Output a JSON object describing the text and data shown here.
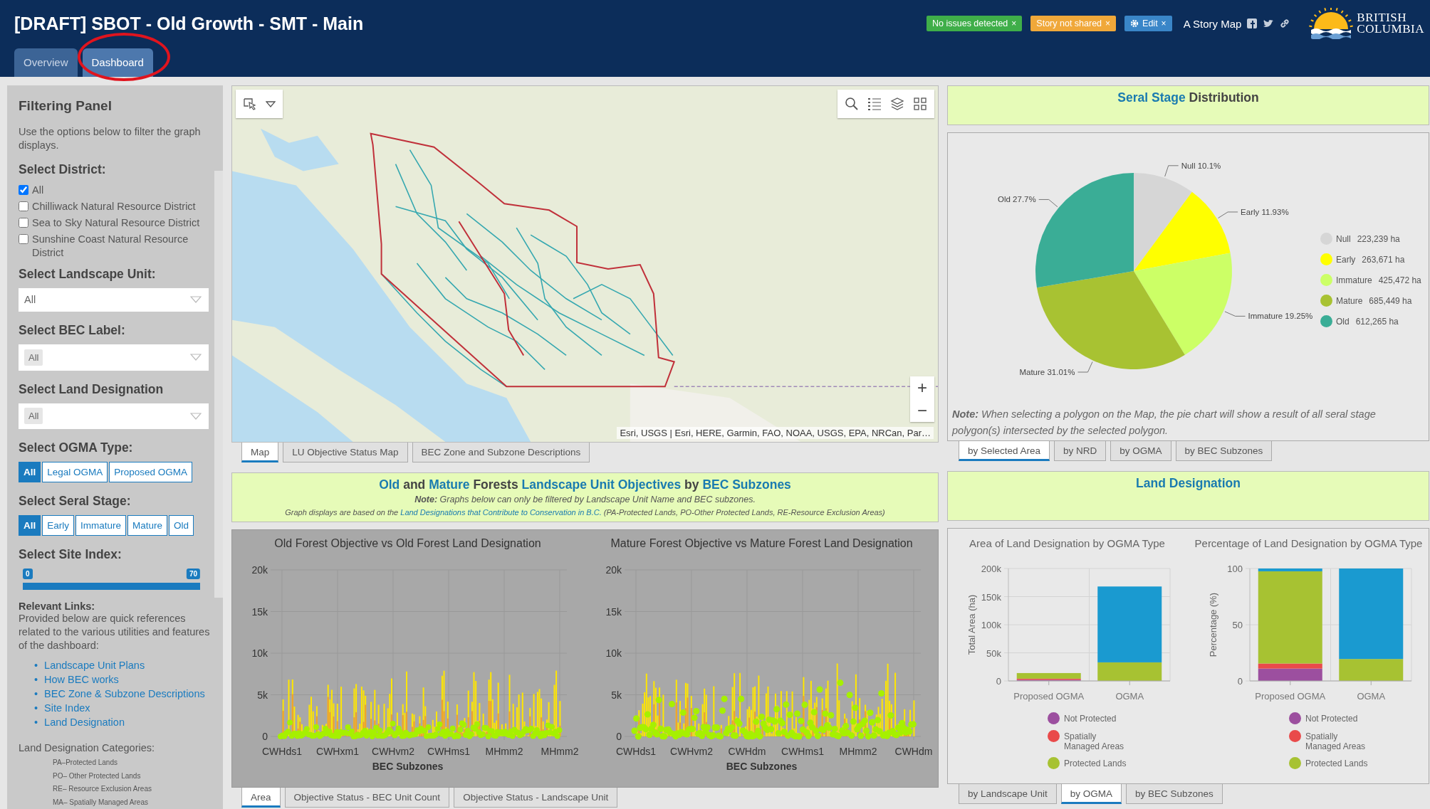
{
  "header": {
    "title": "[DRAFT] SBOT - Old Growth - SMT - Main",
    "badges": [
      {
        "kind": "status",
        "label": "No issues detected",
        "close": "×",
        "color": "#3fae49"
      },
      {
        "kind": "status",
        "label": "Story not shared",
        "close": "×",
        "color": "#f0a83a"
      },
      {
        "kind": "edit",
        "label": "Edit",
        "close": "×",
        "color": "#3a86c8"
      }
    ],
    "story_label": "A Story Map",
    "logo": {
      "line_1": "BRITISH",
      "line_2": "COLUMBIA"
    },
    "tabs": [
      {
        "label": "Overview",
        "selected": false
      },
      {
        "label": "Dashboard",
        "selected": true
      }
    ]
  },
  "filter_panel": {
    "title": "Filtering Panel",
    "description": "Use the options below to filter the graph displays.",
    "district": {
      "label": "Select District:",
      "options": [
        {
          "label": "All",
          "checked": true
        },
        {
          "label": "Chilliwack Natural Resource District",
          "checked": false
        },
        {
          "label": "Sea to Sky Natural Resource District",
          "checked": false
        },
        {
          "label": "Sunshine Coast Natural Resource District",
          "checked": false
        }
      ]
    },
    "dropdowns": [
      {
        "label": "Select Landscape Unit:",
        "value": "All",
        "kind": "plain"
      },
      {
        "label": "Select BEC Label:",
        "value": "All",
        "kind": "chip"
      },
      {
        "label": "Select Land Designation",
        "value": "All",
        "kind": "chip"
      }
    ],
    "ogma": {
      "label": "Select OGMA Type:",
      "options": [
        {
          "label": "All",
          "selected": true
        },
        {
          "label": "Legal OGMA",
          "selected": false
        },
        {
          "label": "Proposed OGMA",
          "selected": false
        }
      ]
    },
    "seral": {
      "label": "Select Seral Stage:",
      "options": [
        {
          "label": "All",
          "selected": true
        },
        {
          "label": "Early",
          "selected": false
        },
        {
          "label": "Immature",
          "selected": false
        },
        {
          "label": "Mature",
          "selected": false
        },
        {
          "label": "Old",
          "selected": false
        }
      ]
    },
    "site_index": {
      "label": "Select Site Index:",
      "low": {
        "value": "0",
        "level": 0
      },
      "high": {
        "value": "70",
        "level": 1
      }
    },
    "links": {
      "title": "Relevant Links:",
      "text": "Provided below are quick references related to the various utilities and features of the dashboard:",
      "bullet": "•",
      "items": [
        "Landscape Unit Plans",
        "How BEC works",
        "BEC Zone & Subzone Descriptions",
        "Site Index",
        "Land Designation"
      ]
    },
    "categories": {
      "title": "Land Designation Categories:",
      "items": [
        "PA–Protected Lands",
        "PO– Other Protected Lands",
        "RE– Resource Exclusion Areas",
        "MA– Spatially Managed Areas"
      ]
    }
  },
  "map": {
    "attribution": "Esri, USGS | Esri, HERE, Garmin, FAO, NOAA, USGS, EPA, NRCan, Par…",
    "zoom_in": "+",
    "zoom_out": "−",
    "tabs": [
      {
        "label": "Map",
        "selected": true
      },
      {
        "label": "LU Objective Status Map",
        "selected": false
      },
      {
        "label": "BEC Zone and Subzone Descriptions",
        "selected": false
      }
    ]
  },
  "objectives": {
    "heading": [
      {
        "text": "Old",
        "accent": true
      },
      {
        "text": "and",
        "accent": false
      },
      {
        "text": "Mature",
        "accent": true
      },
      {
        "text": "Forests",
        "accent": false
      },
      {
        "text": "Landscape Unit Objectives",
        "accent": true
      },
      {
        "text": "by",
        "accent": false
      },
      {
        "text": "BEC Subzones",
        "accent": true
      }
    ],
    "note": "**Note:** Graphs below can only be filtered by Landscape Unit Name and BEC subzones.",
    "basis": {
      "before": "Graph displays are based on the",
      "link": "Land Designations that Contribute to Conservation in B.C.",
      "after": "(PA-Protected Lands, PO-Other Protected Lands, RE-Resource Exclusion Areas)"
    },
    "charts": [
      {
        "title": "Old Forest Objective vs Old Forest Land Designation",
        "yticks": [
          "20k",
          "15k",
          "10k",
          "5k",
          "0"
        ],
        "xlabels": [
          "CWHds1",
          "CWHxm1",
          "CWHvm2",
          "CWHms1",
          "MHmm2",
          "MHmm2"
        ],
        "xlabel": "BEC Subzones"
      },
      {
        "title": "Mature Forest Objective vs Mature Forest Land Designation",
        "yticks": [
          "20k",
          "15k",
          "10k",
          "5k",
          "0"
        ],
        "xlabels": [
          "CWHds1",
          "CWHvm2",
          "CWHdm",
          "CWHms1",
          "MHmm2",
          "CWHdm"
        ],
        "xlabel": "BEC Subzones"
      }
    ],
    "tabs": [
      {
        "label": "Area",
        "selected": true
      },
      {
        "label": "Objective Status - BEC Unit Count",
        "selected": false
      },
      {
        "label": "Objective Status - Landscape Unit",
        "selected": false
      }
    ]
  },
  "seral": {
    "heading": [
      {
        "text": "Seral Stage",
        "accent": true
      },
      {
        "text": "Distribution",
        "accent": false
      }
    ],
    "chart_data": {
      "type": "pie",
      "categories": [
        "Null",
        "Early",
        "Immature",
        "Mature",
        "Old"
      ],
      "values": [
        10.1,
        11.93,
        19.25,
        31.01,
        27.7
      ]
    },
    "slice_labels": [
      "Null 10.1%",
      "Early 11.93%",
      "Immature 19.25%",
      "Mature 31.01%",
      "Old 27.7%"
    ],
    "legend": [
      {
        "area": "223,239 ha",
        "color": "#d6d6d6"
      },
      {
        "area": "263,671 ha",
        "color": "#ffff00"
      },
      {
        "area": "425,472 ha",
        "color": "#ccff66"
      },
      {
        "area": "685,449 ha",
        "color": "#a8c232"
      },
      {
        "area": "612,265 ha",
        "color": "#3aad96"
      }
    ],
    "note": "**Note:** When selecting a polygon on the Map, the pie chart will show a result of all seral stage polygon(s) intersected by the selected polygon.",
    "tabs": [
      {
        "label": "by Selected Area",
        "selected": true
      },
      {
        "label": "by NRD",
        "selected": false
      },
      {
        "label": "by OGMA",
        "selected": false
      },
      {
        "label": "by BEC Subzones",
        "selected": false
      }
    ]
  },
  "land_designation": {
    "heading": [
      {
        "text": "Land Designation",
        "accent": true
      }
    ],
    "charts": [
      {
        "title": "Area of Land Designation by OGMA Type",
        "chart_data": {
          "type": "bar",
          "stacked": true,
          "grid": true,
          "legend": "bottom",
          "ylabel": "Total Area (ha)",
          "categories": [
            "Proposed OGMA",
            "OGMA"
          ],
          "ylim": [
            0,
            200000
          ],
          "yticks": [
            0,
            {
              "value": 50000,
              "label": "50k"
            },
            {
              "value": 100000,
              "label": "100k"
            },
            {
              "value": 150000,
              "label": "150k"
            },
            {
              "value": 200000,
              "label": "200k"
            }
          ],
          "series": [
            {
              "name": "Not Protected",
              "color": "#9c4f9f",
              "values": [
                2000,
                0
              ]
            },
            {
              "name": "Spatially Managed Areas",
              "color": "#e94a4a",
              "values": [
                2000,
                0
              ]
            },
            {
              "name": "Protected Lands",
              "color": "#a7c232",
              "values": [
                10000,
                33000
              ]
            },
            {
              "color": "#1a9ad0",
              "values": [
                0,
                135000
              ]
            }
          ]
        }
      },
      {
        "title": "Percentage of Land Designation by OGMA Type",
        "chart_data": {
          "type": "bar",
          "stacked": true,
          "grid": true,
          "legend": "bottom",
          "ylabel": "Percentage (%)",
          "categories": [
            "Proposed OGMA",
            "OGMA"
          ],
          "ylim": [
            0,
            100
          ],
          "yticks": [
            0,
            50,
            100
          ],
          "series": [
            {
              "name": "Not Protected",
              "color": "#9c4f9f",
              "values": [
                11,
                0
              ]
            },
            {
              "name": "Spatially Managed Areas",
              "color": "#e94a4a",
              "values": [
                4.5,
                0
              ]
            },
            {
              "name": "Protected Lands",
              "color": "#a7c232",
              "values": [
                82,
                19.5
              ]
            },
            {
              "color": "#1a9ad0",
              "values": [
                2.5,
                80.5
              ]
            }
          ]
        }
      }
    ],
    "tabs": [
      {
        "label": "by Landscape Unit",
        "selected": false
      },
      {
        "label": "by OGMA",
        "selected": true
      },
      {
        "label": "by BEC Subzones",
        "selected": false
      }
    ]
  }
}
